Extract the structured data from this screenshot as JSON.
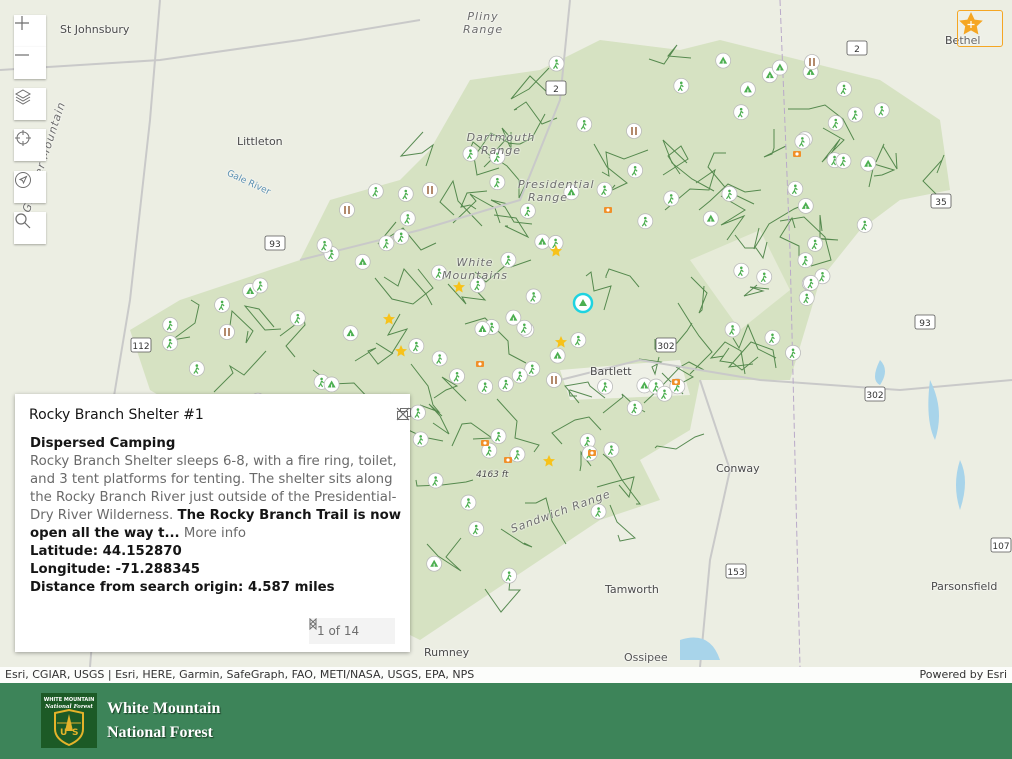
{
  "map": {
    "labels": {
      "st_johnsbury": "St Johnsbury",
      "pliny_range": "Pliny Range",
      "bethel": "Bethel",
      "littleton": "Littleton",
      "dartmouth_range": "Dartmouth Range",
      "presidential_range": "Presidential Range",
      "white_mountains": "White Mountains",
      "gardner_mountain": "Gardner Mountain",
      "gale_river": "Gale River",
      "bartlett": "Bartlett",
      "conway": "Conway",
      "sandwich_range": "Sandwich Range",
      "tamworth": "Tamworth",
      "parsonsfield": "Parsonsfield",
      "rumney": "Rumney",
      "ossipee": "Ossipee",
      "elevation": "4163 ft"
    },
    "shields": [
      "2",
      "93",
      "112",
      "302",
      "35",
      "93",
      "302",
      "153",
      "107",
      "2"
    ],
    "colors": {
      "forest": "#d3e0bd",
      "trail": "#3f7a3a",
      "marker_icon": "#4caf50",
      "star": "#f7c21a",
      "selected": "#1ed3e0",
      "favorite": "#f5a623"
    }
  },
  "controls": {
    "zoom_in": "zoom-in",
    "zoom_out": "zoom-out",
    "layers": "layers",
    "locate": "locate",
    "navigate": "navigate",
    "search": "search",
    "favorite": "favorites"
  },
  "popup": {
    "title": "Rocky Branch Shelter #1",
    "category": "Dispersed Camping",
    "description": "Rocky Branch Shelter sleeps 6-8, with a fire ring, toilet, and 3 tent platforms for tenting. The shelter sits along the Rocky Branch River just outside of the Presidential-Dry River Wilderness. ",
    "description_bold": "The Rocky Branch Trail is now open all the way t...",
    "more_info": "More info",
    "latitude": "Latitude: 44.152870",
    "longitude": "Longitude: -71.288345",
    "distance": "Distance from search origin: 4.587 miles",
    "pager": "1 of 14"
  },
  "attribution": {
    "left": "Esri, CGIAR, USGS | Esri, HERE, Garmin, SafeGraph, FAO, METI/NASA, USGS, EPA, NPS",
    "right": "Powered by Esri"
  },
  "footer": {
    "line1": "White Mountain",
    "line2": "National Forest",
    "logo_text": "WHITE MOUNTAIN National Forest US"
  }
}
